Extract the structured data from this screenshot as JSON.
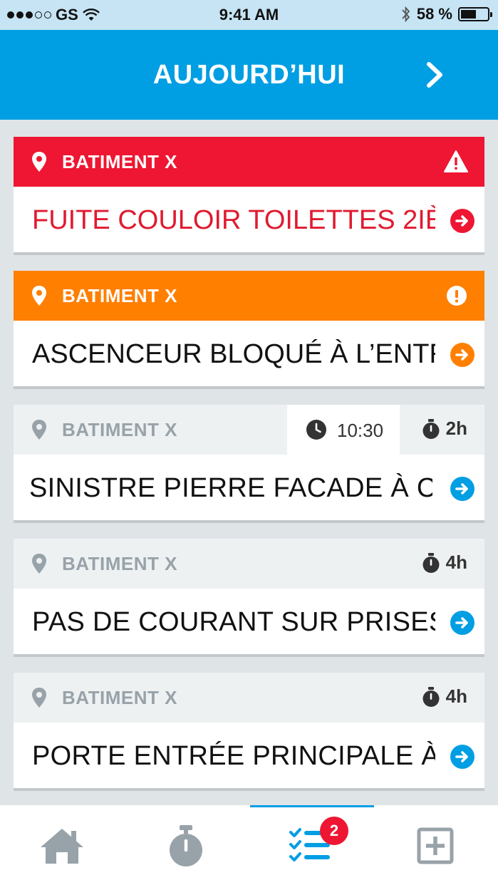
{
  "status_bar": {
    "carrier": "GS",
    "time": "9:41 AM",
    "battery": "58 %",
    "battery_level": 0.58
  },
  "header": {
    "title": "AUJOURD’HUI",
    "next_icon": "chevron-right-icon"
  },
  "colors": {
    "accent": "#009ee3",
    "urgent": "#ee1632",
    "important": "#ff7f00",
    "normal_header": "#eef1f2",
    "inactive_icon": "#98a2a9"
  },
  "tasks": [
    {
      "building": "BATIMENT X",
      "title": "FUITE COULOIR TOILETTES 2IÈ",
      "priority": "urgent",
      "status_icon": "warning-triangle-icon"
    },
    {
      "building": "BATIMENT X",
      "title": "ASCENCEUR BLOQUÉ À L’ENTR",
      "priority": "important",
      "status_icon": "exclamation-circle-icon"
    },
    {
      "building": "BATIMENT X",
      "title": "SINISTRE PIERRE FACADE À CO",
      "priority": "normal",
      "scheduled_time": "10:30",
      "duration": "2h"
    },
    {
      "building": "BATIMENT X",
      "title": "PAS DE COURANT SUR PRISES",
      "priority": "normal",
      "duration": "4h"
    },
    {
      "building": "BATIMENT X",
      "title": "PORTE ENTRÉE PRINCIPALE À",
      "priority": "normal",
      "duration": "4h"
    }
  ],
  "tab_bar": {
    "tabs": [
      {
        "icon": "home-icon"
      },
      {
        "icon": "stopwatch-icon"
      },
      {
        "icon": "task-list-icon",
        "badge": "2",
        "active": true
      },
      {
        "icon": "add-square-icon"
      }
    ]
  }
}
